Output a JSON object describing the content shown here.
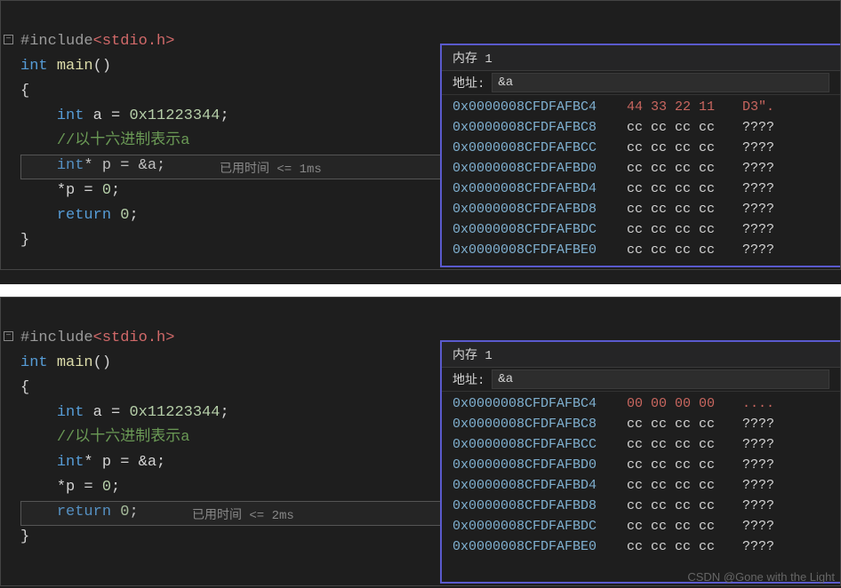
{
  "panel1": {
    "code": {
      "l1_pre": "#include",
      "l1_hdr": "<stdio.h>",
      "l2_kw": "int",
      "l2_fn": "main",
      "l2_par": "()",
      "l3": "{",
      "l4_kw": "int",
      "l4_var": " a ",
      "l4_eq": "= ",
      "l4_num": "0x11223344",
      "l4_semi": ";",
      "l5": "//以十六进制表示a",
      "l6_kw": "int",
      "l6_op": "*",
      "l6_var": " p ",
      "l6_eq": "= ",
      "l6_amp": "&a",
      "l6_semi": ";",
      "l7_star": "*",
      "l7_var": "p ",
      "l7_eq": "= ",
      "l7_num": "0",
      "l7_semi": ";",
      "l8_kw": "return",
      "l8_num": " 0",
      "l8_semi": ";",
      "l9": "}"
    },
    "exec_tip": "已用时间 <= 1ms",
    "mem": {
      "title": "内存 1",
      "addr_label": "地址:",
      "addr_value": "&a",
      "rows": [
        {
          "addr": "0x0000008CFDFAFBC4",
          "bytes": "44 33 22 11",
          "ascii": "D3\".",
          "hi": true
        },
        {
          "addr": "0x0000008CFDFAFBC8",
          "bytes": "cc cc cc cc",
          "ascii": "????",
          "hi": false
        },
        {
          "addr": "0x0000008CFDFAFBCC",
          "bytes": "cc cc cc cc",
          "ascii": "????",
          "hi": false
        },
        {
          "addr": "0x0000008CFDFAFBD0",
          "bytes": "cc cc cc cc",
          "ascii": "????",
          "hi": false
        },
        {
          "addr": "0x0000008CFDFAFBD4",
          "bytes": "cc cc cc cc",
          "ascii": "????",
          "hi": false
        },
        {
          "addr": "0x0000008CFDFAFBD8",
          "bytes": "cc cc cc cc",
          "ascii": "????",
          "hi": false
        },
        {
          "addr": "0x0000008CFDFAFBDC",
          "bytes": "cc cc cc cc",
          "ascii": "????",
          "hi": false
        },
        {
          "addr": "0x0000008CFDFAFBE0",
          "bytes": "cc cc cc cc",
          "ascii": "????",
          "hi": false
        }
      ]
    }
  },
  "panel2": {
    "code": {
      "l1_pre": "#include",
      "l1_hdr": "<stdio.h>",
      "l2_kw": "int",
      "l2_fn": "main",
      "l2_par": "()",
      "l3": "{",
      "l4_kw": "int",
      "l4_var": " a ",
      "l4_eq": "= ",
      "l4_num": "0x11223344",
      "l4_semi": ";",
      "l5": "//以十六进制表示a",
      "l6_kw": "int",
      "l6_op": "*",
      "l6_var": " p ",
      "l6_eq": "= ",
      "l6_amp": "&a",
      "l6_semi": ";",
      "l7_star": "*",
      "l7_var": "p ",
      "l7_eq": "= ",
      "l7_num": "0",
      "l7_semi": ";",
      "l8_kw": "return",
      "l8_num": " 0",
      "l8_semi": ";",
      "l9": "}"
    },
    "exec_tip": "已用时间 <= 2ms",
    "mem": {
      "title": "内存 1",
      "addr_label": "地址:",
      "addr_value": "&a",
      "rows": [
        {
          "addr": "0x0000008CFDFAFBC4",
          "bytes": "00 00 00 00",
          "ascii": "....",
          "hi": true
        },
        {
          "addr": "0x0000008CFDFAFBC8",
          "bytes": "cc cc cc cc",
          "ascii": "????",
          "hi": false
        },
        {
          "addr": "0x0000008CFDFAFBCC",
          "bytes": "cc cc cc cc",
          "ascii": "????",
          "hi": false
        },
        {
          "addr": "0x0000008CFDFAFBD0",
          "bytes": "cc cc cc cc",
          "ascii": "????",
          "hi": false
        },
        {
          "addr": "0x0000008CFDFAFBD4",
          "bytes": "cc cc cc cc",
          "ascii": "????",
          "hi": false
        },
        {
          "addr": "0x0000008CFDFAFBD8",
          "bytes": "cc cc cc cc",
          "ascii": "????",
          "hi": false
        },
        {
          "addr": "0x0000008CFDFAFBDC",
          "bytes": "cc cc cc cc",
          "ascii": "????",
          "hi": false
        },
        {
          "addr": "0x0000008CFDFAFBE0",
          "bytes": "cc cc cc cc",
          "ascii": "????",
          "hi": false
        }
      ]
    },
    "watermark": "CSDN @Gone with the Light"
  }
}
